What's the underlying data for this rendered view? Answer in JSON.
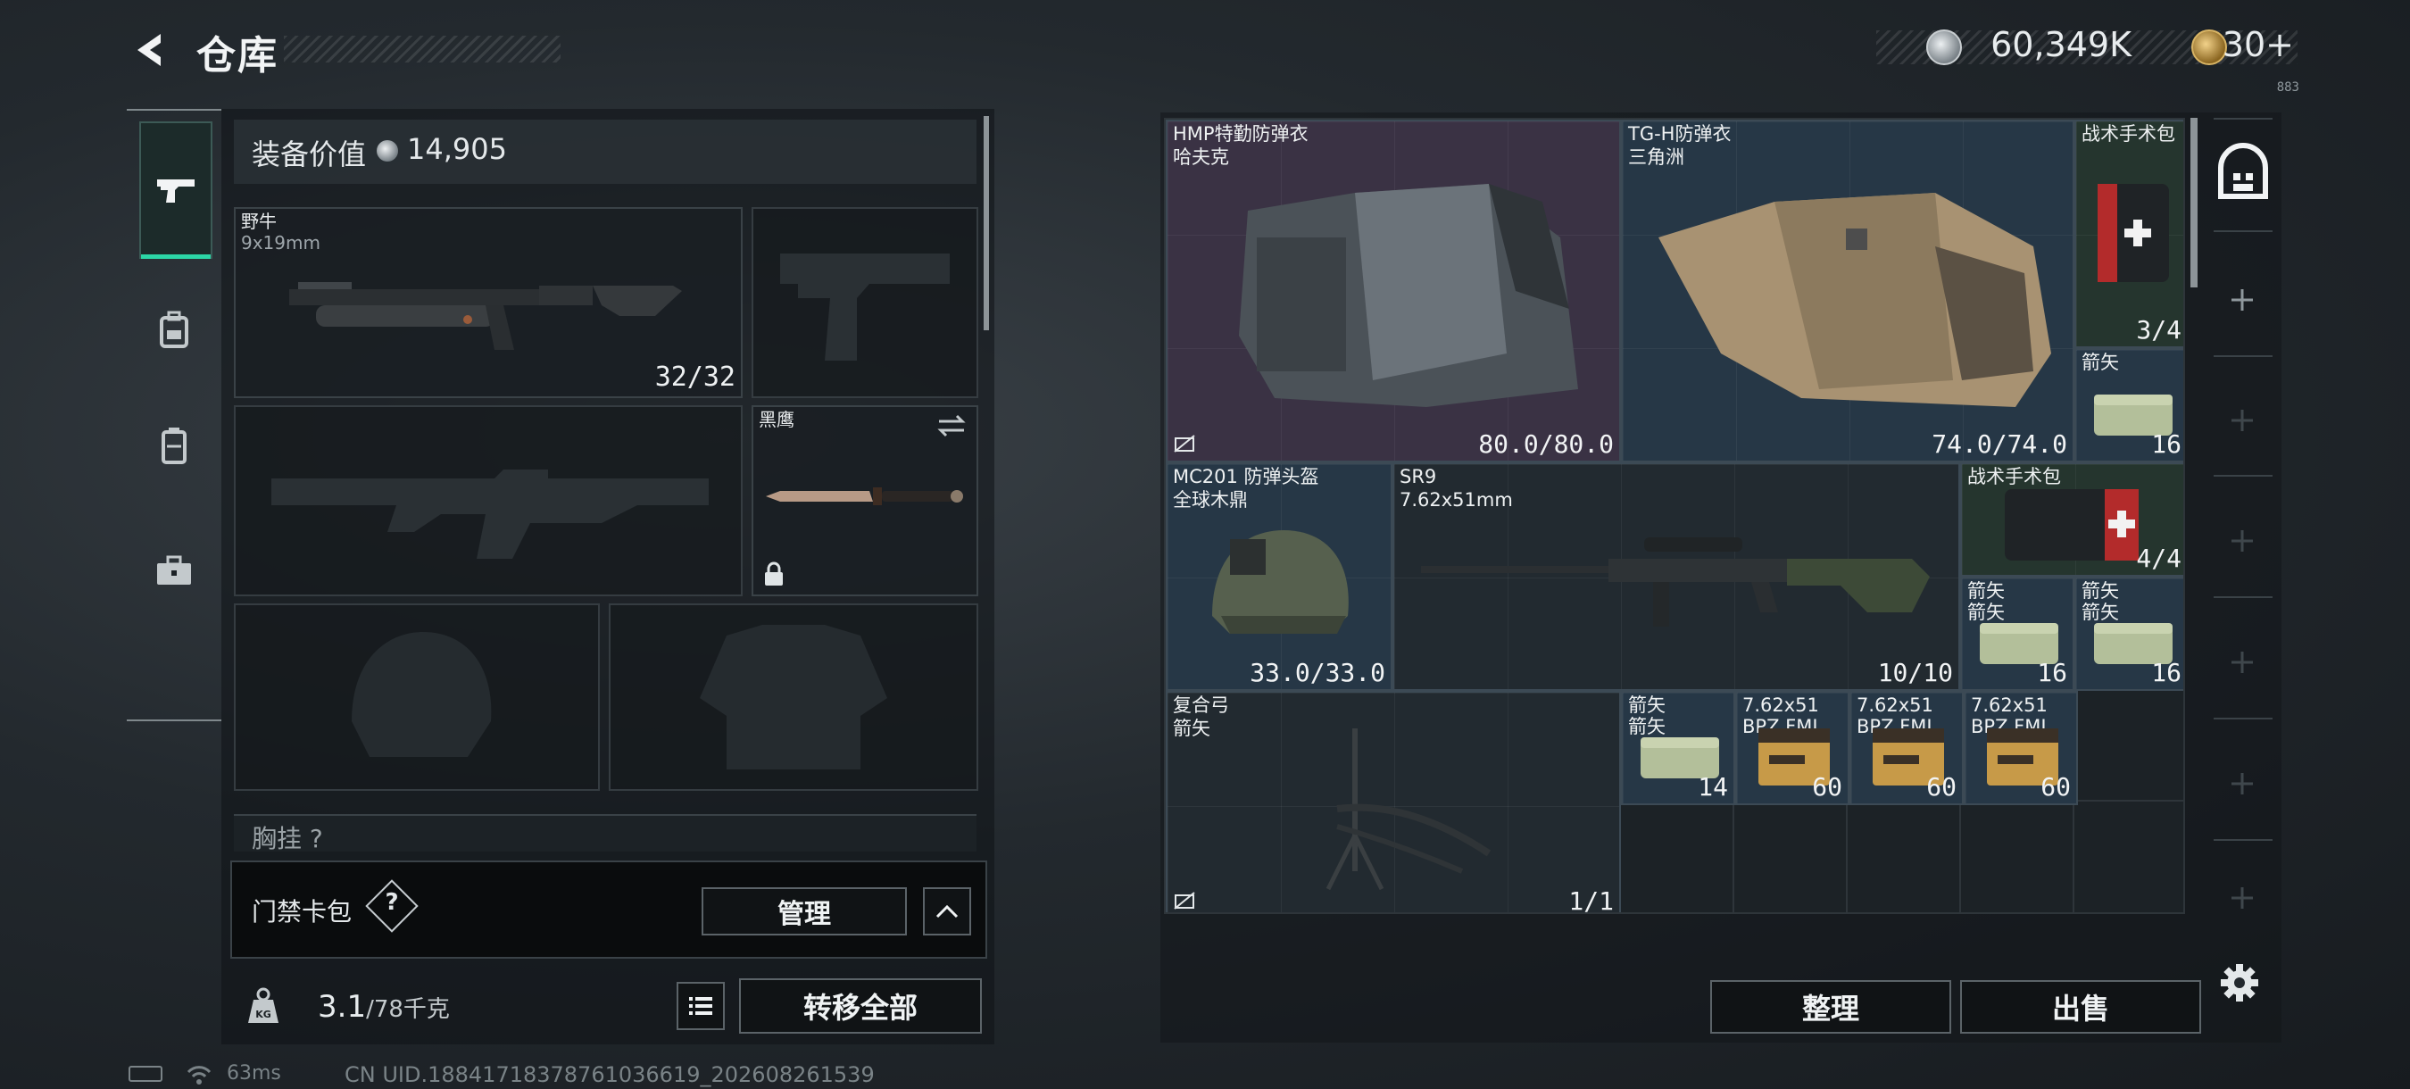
{
  "header": {
    "title": "仓库",
    "coins": "60,349K",
    "gold": "30+",
    "tiny_code": "883"
  },
  "left_nav": {
    "items": [
      "weapon",
      "backpack",
      "vest",
      "case"
    ]
  },
  "loadout": {
    "equip_value_label": "装备价值",
    "equip_value": "14,905",
    "primary_weapon": {
      "name": "野牛",
      "ammo": "9x19mm",
      "count": "32/32"
    },
    "melee": {
      "name": "黑鹰"
    },
    "chest_rig_label": "胸挂 ?",
    "keycard_label": "门禁卡包",
    "keycard_help": "?",
    "manage_button": "管理",
    "weight_value": "3.1",
    "weight_capacity": "/78千克",
    "transfer_all_button": "转移全部"
  },
  "status": {
    "ping": "63ms",
    "uid": "CN UID.18841718378761036619_202608261539"
  },
  "stash": {
    "items": [
      {
        "name": "HMP特勤防弹衣",
        "sub": "哈夫克",
        "qty": "80.0/80.0"
      },
      {
        "name": "TG-H防弹衣",
        "sub": "三角洲",
        "qty": "74.0/74.0"
      },
      {
        "name": "战术手术包",
        "sub": "",
        "qty": "3/4"
      },
      {
        "name": "箭矢",
        "sub": "",
        "qty": "16"
      },
      {
        "name": "MC201 防弹头盔",
        "sub": "全球木鼎",
        "qty": "33.0/33.0"
      },
      {
        "name": "SR9",
        "sub": "7.62x51mm",
        "qty": "10/10"
      },
      {
        "name": "战术手术包",
        "sub": "",
        "qty": "4/4"
      },
      {
        "name": "箭矢",
        "sub": "箭矢",
        "qty": "16"
      },
      {
        "name": "箭矢",
        "sub": "箭矢",
        "qty": "16"
      },
      {
        "name": "复合弓",
        "sub": "箭矢",
        "qty": "1/1"
      },
      {
        "name": "箭矢",
        "sub": "箭矢",
        "qty": "14"
      },
      {
        "name": "7.62x51",
        "sub": "BPZ FMJ",
        "qty": "60"
      },
      {
        "name": "7.62x51",
        "sub": "BPZ FMJ",
        "qty": "60"
      },
      {
        "name": "7.62x51",
        "sub": "BPZ FMJ",
        "qty": "60"
      }
    ],
    "sort_button": "整理",
    "sell_button": "出售"
  },
  "colors": {
    "accent": "#2cd6a6",
    "rarity_blue": "#263746",
    "rarity_purple": "#3a3244",
    "rarity_green": "#25352e"
  }
}
